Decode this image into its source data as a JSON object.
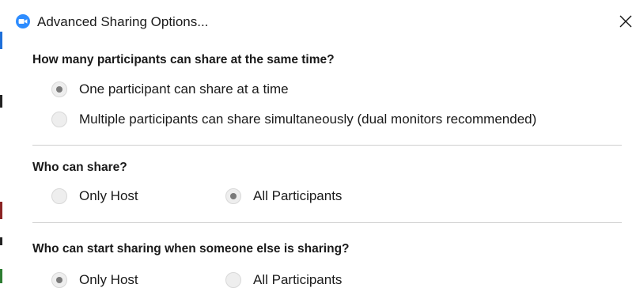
{
  "dialog": {
    "title": "Advanced Sharing Options...",
    "app_icon": "zoom-logo-icon",
    "close_icon": "close-icon"
  },
  "sections": [
    {
      "title": "How many participants can share at the same time?",
      "options": [
        {
          "label": "One participant can share at a time",
          "selected": true
        },
        {
          "label": "Multiple participants can share simultaneously (dual monitors recommended)",
          "selected": false
        }
      ]
    },
    {
      "title": "Who can share?",
      "options": [
        {
          "label": "Only Host",
          "selected": false
        },
        {
          "label": "All Participants",
          "selected": true
        }
      ]
    },
    {
      "title": "Who can start sharing when someone else is sharing?",
      "options": [
        {
          "label": "Only Host",
          "selected": true
        },
        {
          "label": "All Participants",
          "selected": false
        }
      ]
    }
  ],
  "colors": {
    "accent": "#2d8cff",
    "radio_fill": "#eeeeee",
    "radio_dot": "#7a7a7a",
    "divider": "#cfcfcf"
  }
}
